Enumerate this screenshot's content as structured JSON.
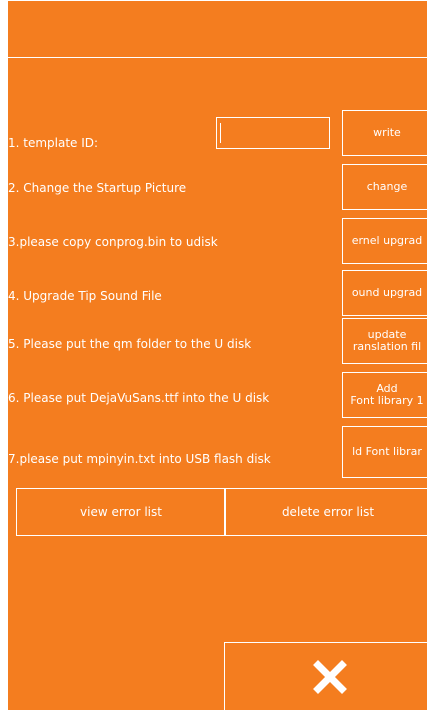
{
  "template_label": "1. template ID:",
  "template_input_value": "",
  "write_label": "write",
  "rows": [
    {
      "label": "2. Change the Startup Picture",
      "button": "change"
    },
    {
      "label": "3.please copy conprog.bin to udisk",
      "button": "ernel upgrad"
    },
    {
      "label": "4. Upgrade Tip Sound File",
      "button": "ound upgrad"
    },
    {
      "label": "5. Please put the qm folder to the U disk",
      "button_line1": "update",
      "button_line2": "ranslation fil"
    },
    {
      "label": "6. Please put DejaVuSans.ttf into the U disk",
      "button_line1": "Add",
      "button_line2": "Font library 1"
    },
    {
      "label": "7.please put mpinyin.txt into USB flash disk",
      "button": "ld Font librar"
    }
  ],
  "view_error_list": "view error list",
  "delete_error_list": "delete error list",
  "close_icon": "close-icon",
  "colors": {
    "background": "#f47d1f",
    "foreground": "#ffffff"
  }
}
